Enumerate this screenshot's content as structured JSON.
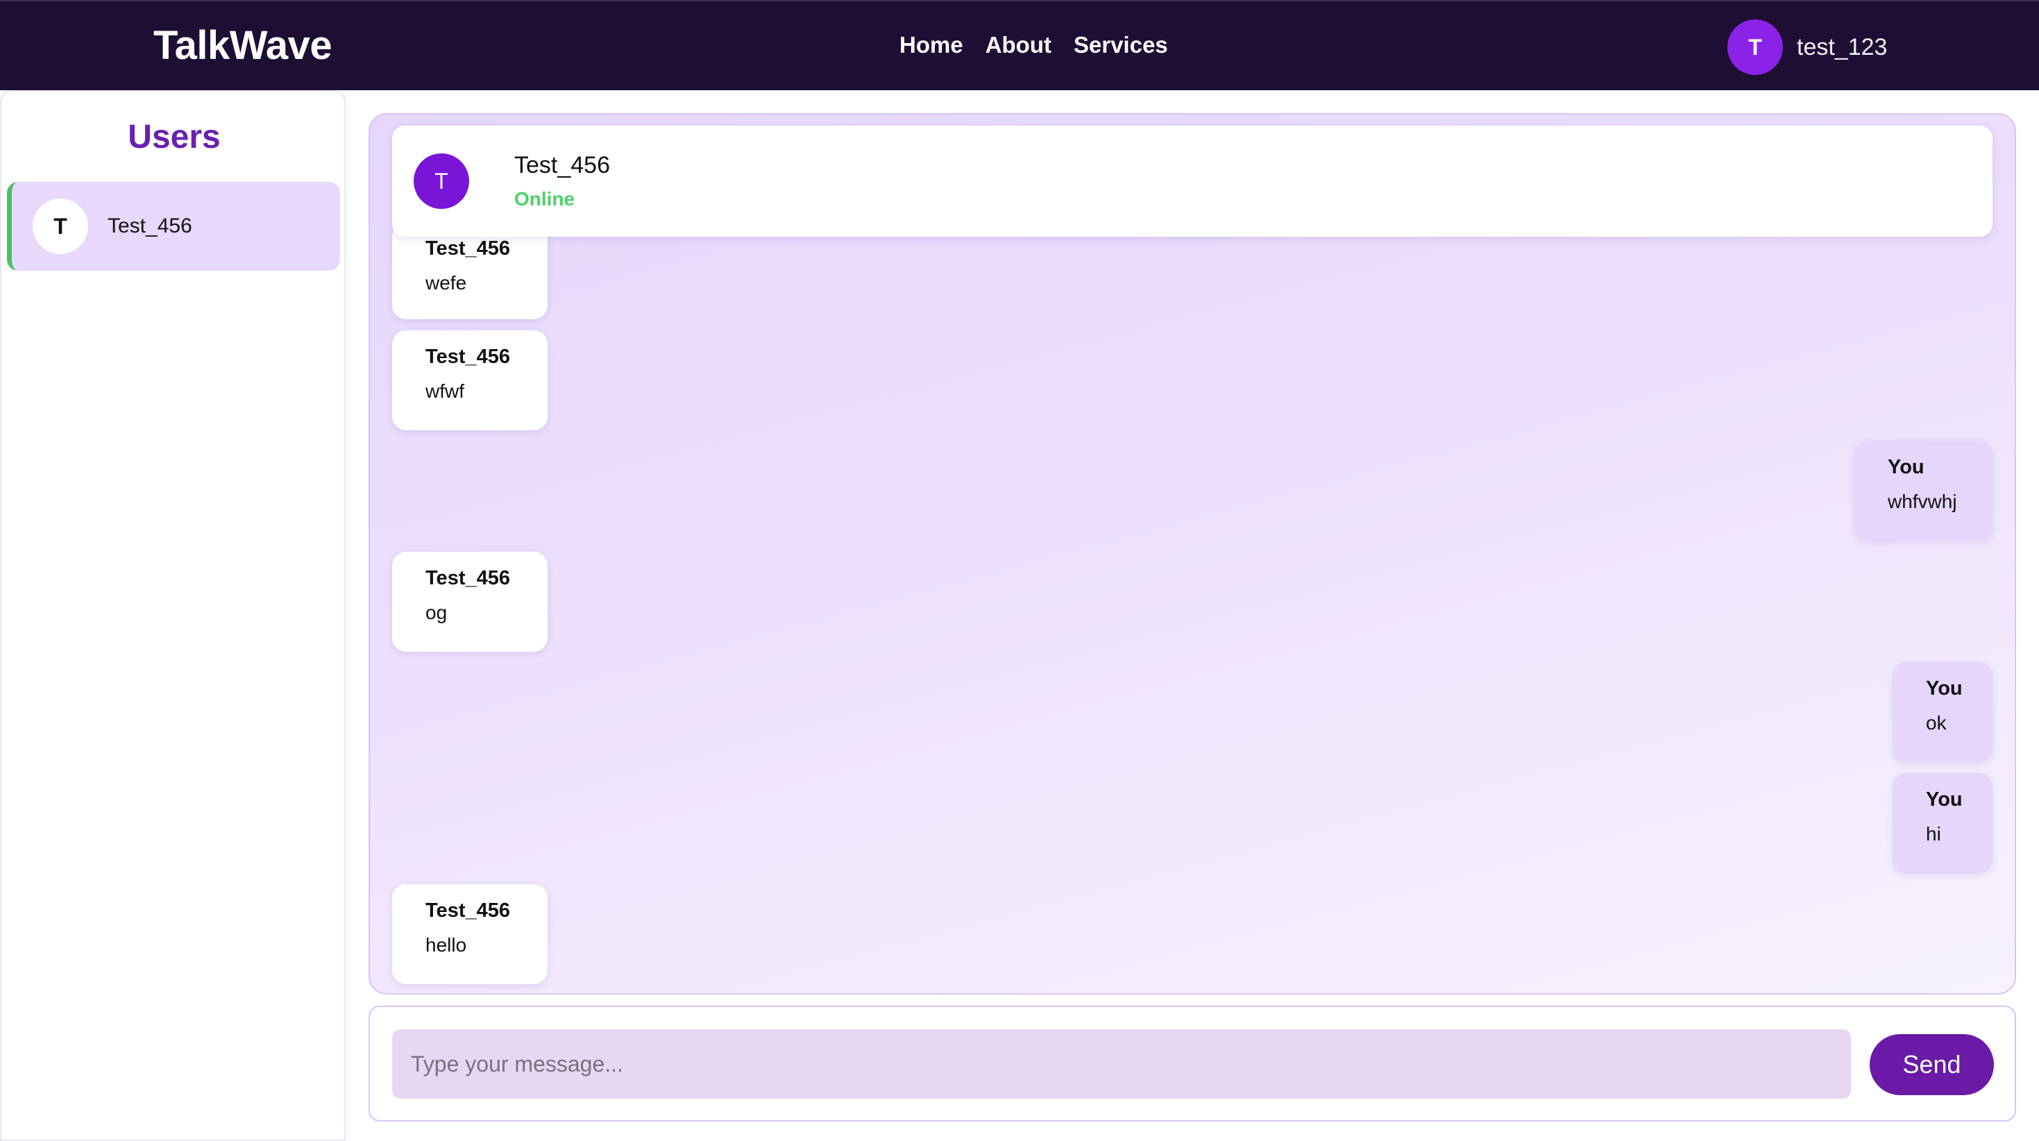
{
  "navbar": {
    "brand": "TalkWave",
    "links": [
      "Home",
      "About",
      "Services"
    ],
    "user": {
      "initial": "T",
      "name": "test_123"
    }
  },
  "sidebar": {
    "title": "Users",
    "users": [
      {
        "initial": "T",
        "name": "Test_456",
        "status_color": "#4fc06a"
      }
    ]
  },
  "chat": {
    "contact": {
      "initial": "T",
      "name": "Test_456",
      "status": "Online"
    },
    "messages": [
      {
        "sender": "Test_456",
        "text": "wefe",
        "direction": "in"
      },
      {
        "sender": "Test_456",
        "text": "wfwf",
        "direction": "in"
      },
      {
        "sender": "You",
        "text": "whfvwhj",
        "direction": "out"
      },
      {
        "sender": "Test_456",
        "text": "og",
        "direction": "in"
      },
      {
        "sender": "You",
        "text": "ok",
        "direction": "out"
      },
      {
        "sender": "You",
        "text": "hi",
        "direction": "out"
      },
      {
        "sender": "Test_456",
        "text": "hello",
        "direction": "in"
      }
    ]
  },
  "composer": {
    "placeholder": "Type your message...",
    "value": "",
    "send_label": "Send"
  },
  "colors": {
    "navbar_bg": "#1e0e34",
    "accent_purple": "#6a1fb0",
    "online_green": "#4fd06a",
    "outgoing_bubble": "#e6d6fb"
  }
}
